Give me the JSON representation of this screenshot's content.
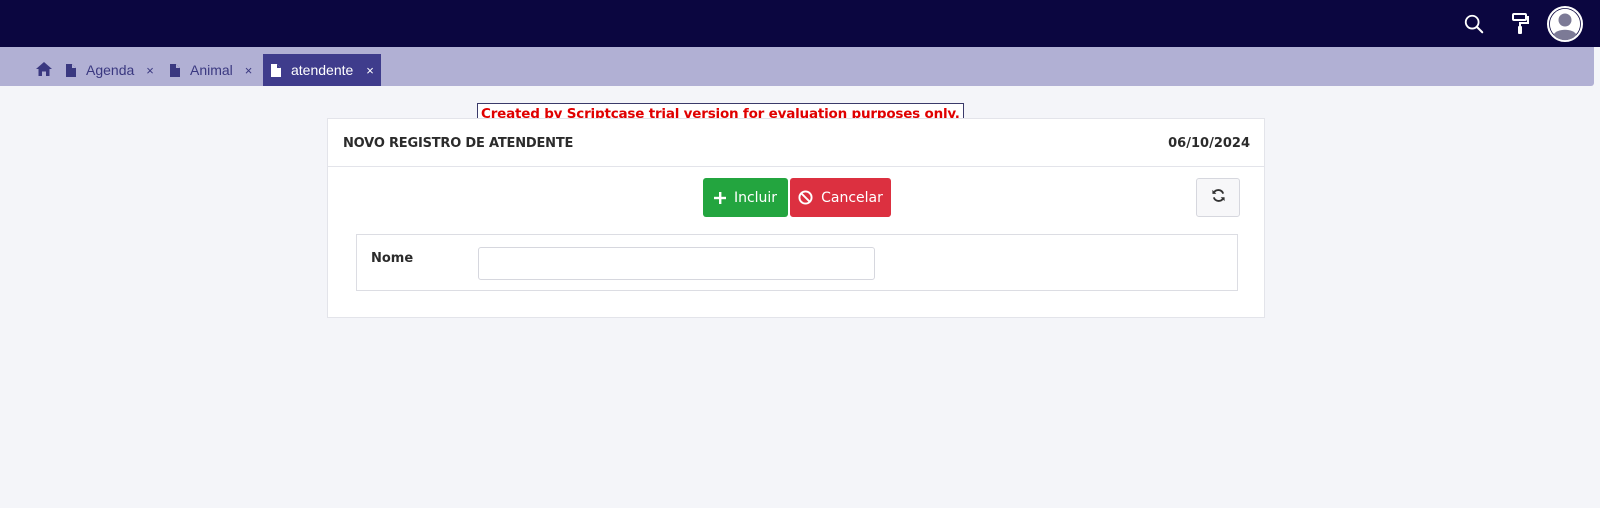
{
  "topbar": {
    "icons": [
      "search-icon",
      "paint-roller-icon",
      "user-avatar-icon"
    ],
    "background": "#0b0640"
  },
  "tabs": {
    "home_icon": "home-icon",
    "items": [
      {
        "label": "Agenda",
        "icon": "document-icon",
        "active": false
      },
      {
        "label": "Animal",
        "icon": "document-icon",
        "active": false
      },
      {
        "label": "atendente",
        "icon": "document-icon",
        "active": true
      }
    ],
    "close_glyph": "×"
  },
  "trial_notice": "Created by Scriptcase trial version for evaluation purposes only.",
  "form": {
    "title": "NOVO REGISTRO DE ATENDENTE",
    "date": "06/10/2024",
    "buttons": {
      "incluir": {
        "label": "Incluir",
        "icon": "plus-icon",
        "color": "#23a53f"
      },
      "cancelar": {
        "label": "Cancelar",
        "icon": "ban-icon",
        "color": "#dc3040"
      },
      "refresh": {
        "icon": "refresh-icon"
      }
    },
    "fields": {
      "nome": {
        "label": "Nome",
        "value": "",
        "placeholder": ""
      }
    }
  }
}
